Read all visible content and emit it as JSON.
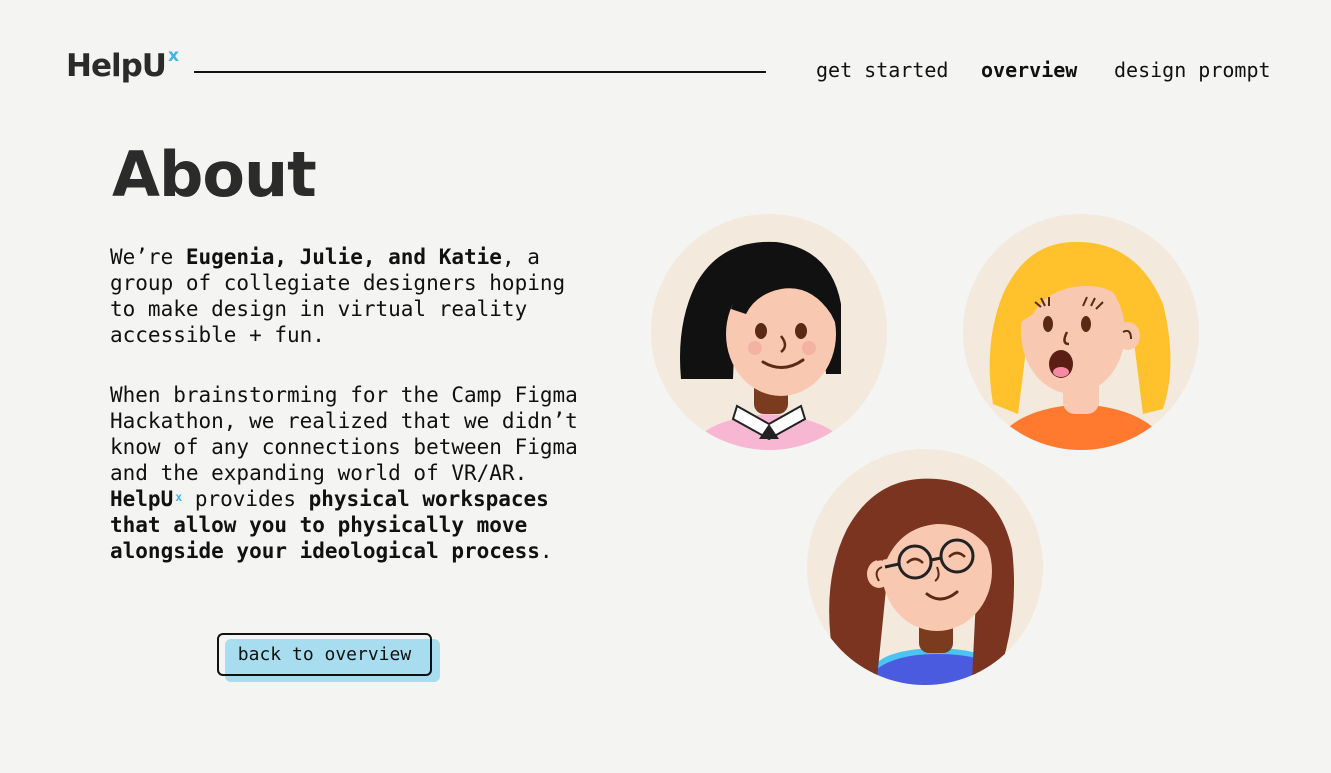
{
  "logo": {
    "text": "HelpU",
    "sup": "x"
  },
  "nav": {
    "get_started": "get started",
    "overview": "overview",
    "design_prompt": "design prompt"
  },
  "page_title": "About",
  "intro": {
    "p1_a": "We’re ",
    "p1_names": "Eugenia, Julie, and Katie",
    "p1_b": ", a group of collegiate designers hoping to make design in virtual reality accessible + fun.",
    "p2_a": "When brainstorming for the Camp Figma Hackathon, we realized that we didn’t know of any connections between Figma and the expanding world of VR/AR. ",
    "p2_brand": "HelpU",
    "p2_brand_sup": "x",
    "p2_b": " provides ",
    "p2_bold": "physical workspaces that allow you to physically move alongside your ideological process",
    "p2_c": "."
  },
  "back_button": "back to overview",
  "colors": {
    "background": "#f4f4f2",
    "accent": "#3cb8e6",
    "button_fill": "#a8dcef",
    "avatar_bg": "#f3e9dc"
  }
}
